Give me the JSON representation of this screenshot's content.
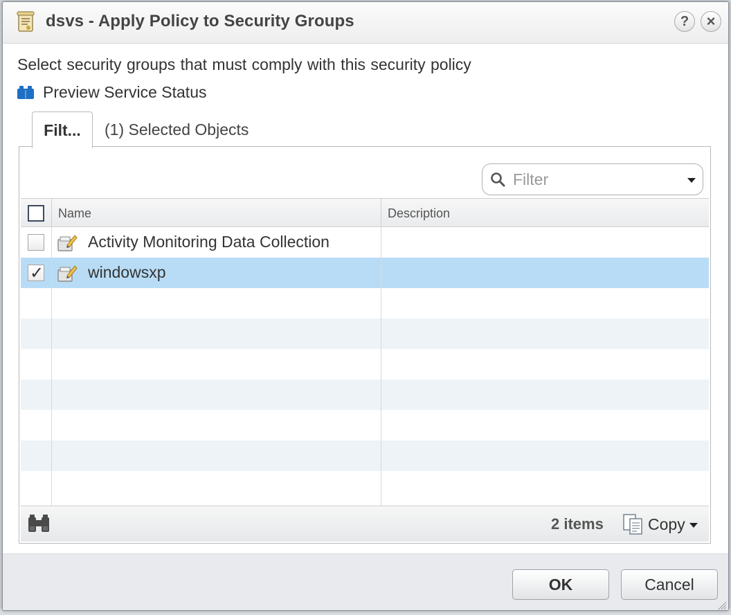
{
  "dialog": {
    "title": "dsvs - Apply Policy to Security Groups",
    "help_glyph": "?",
    "close_glyph": "×"
  },
  "instruction": "Select security groups that must comply with this security policy",
  "preview_link": "Preview Service Status",
  "tabs": [
    {
      "label": "Filt...",
      "active": true
    },
    {
      "label": "(1) Selected Objects",
      "active": false
    }
  ],
  "filter": {
    "placeholder": "Filter",
    "value": ""
  },
  "grid": {
    "columns": [
      "Name",
      "Description"
    ],
    "rows": [
      {
        "name": "Activity Monitoring Data Collection",
        "description": "",
        "checked": false,
        "selected": false
      },
      {
        "name": "windowsxp",
        "description": "",
        "checked": true,
        "selected": true
      }
    ]
  },
  "footer": {
    "items_count": "2 items",
    "copy_label": "Copy"
  },
  "buttons": {
    "ok": "OK",
    "cancel": "Cancel"
  },
  "colors": {
    "selected_row": "#b8dcf5",
    "alt_row": "#eef3f7",
    "icon_blue": "#1f6fc5"
  },
  "icons": {
    "title": "policy-scroll-icon",
    "preview": "service-status-icon",
    "filter": "search-icon",
    "row": "security-group-icon",
    "footer_find": "binoculars-icon",
    "copy": "copy-icon"
  }
}
